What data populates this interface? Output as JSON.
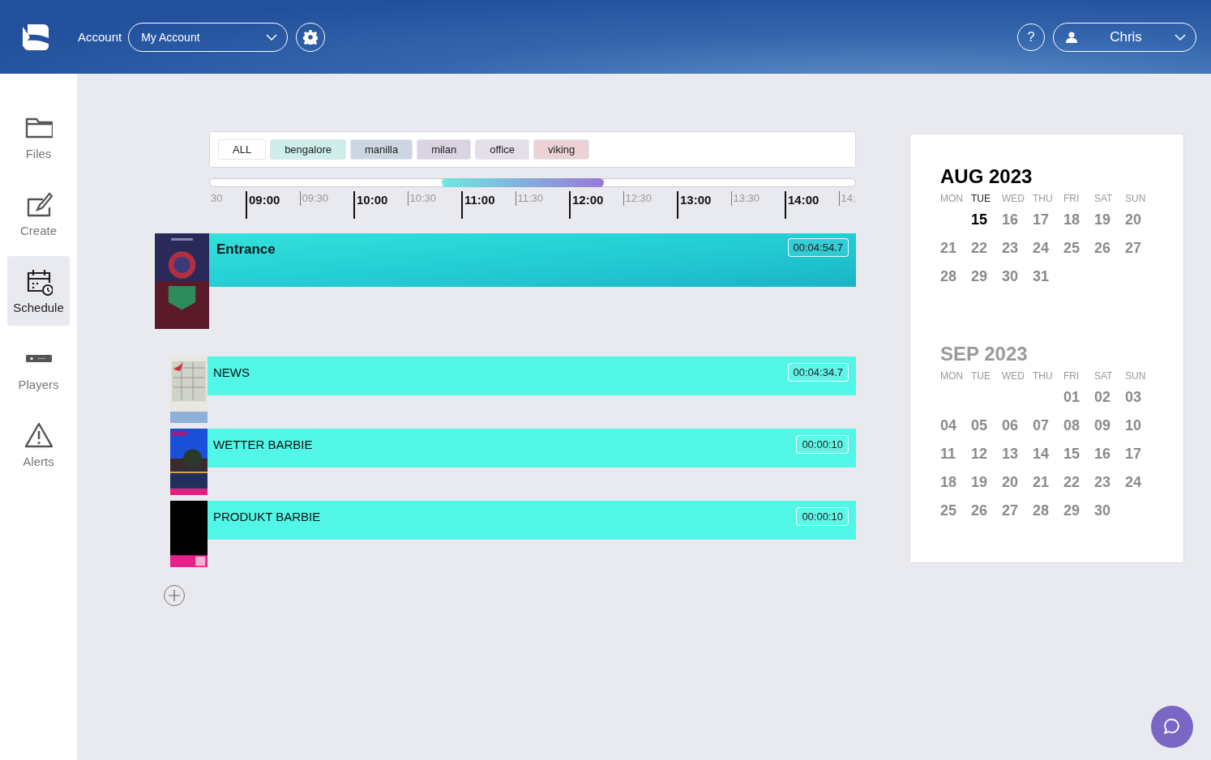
{
  "header": {
    "account_label": "Account",
    "account_select": {
      "value": "My Account"
    },
    "user_select": {
      "value": "Chris"
    },
    "help_button": "?"
  },
  "sidebar": {
    "items": [
      {
        "label": "Files",
        "selected": false
      },
      {
        "label": "Create",
        "selected": false
      },
      {
        "label": "Schedule",
        "selected": true
      },
      {
        "label": "Players",
        "selected": false
      },
      {
        "label": "Alerts",
        "selected": false
      }
    ]
  },
  "filters": [
    {
      "label": "ALL",
      "color": "#ffffff"
    },
    {
      "label": "bengalore",
      "color": "#cdeeea"
    },
    {
      "label": "manilla",
      "color": "#cbd6e2"
    },
    {
      "label": "milan",
      "color": "#dbd3e2"
    },
    {
      "label": "office",
      "color": "#e5dfec"
    },
    {
      "label": "viking",
      "color": "#ecd2d5"
    }
  ],
  "timeline": {
    "ticks": [
      {
        "label": "30",
        "kind": "partial"
      },
      {
        "label": "09:00",
        "kind": "hour"
      },
      {
        "label": "09:30",
        "kind": "half"
      },
      {
        "label": "10:00",
        "kind": "hour"
      },
      {
        "label": "10:30",
        "kind": "half"
      },
      {
        "label": "11:00",
        "kind": "hour"
      },
      {
        "label": "11:30",
        "kind": "half"
      },
      {
        "label": "12:00",
        "kind": "hour"
      },
      {
        "label": "12:30",
        "kind": "half"
      },
      {
        "label": "13:00",
        "kind": "hour"
      },
      {
        "label": "13:30",
        "kind": "half"
      },
      {
        "label": "14:00",
        "kind": "hour"
      },
      {
        "label": "14:",
        "kind": "half"
      }
    ]
  },
  "schedule": {
    "rows": [
      {
        "kind": "group",
        "name": "Entrance",
        "duration": "00:04:54.7"
      },
      {
        "kind": "item",
        "name": "NEWS",
        "duration": "00:04:34.7"
      },
      {
        "kind": "item",
        "name": "WETTER BARBIE",
        "duration": "00:00:10"
      },
      {
        "kind": "item",
        "name": "PRODUKT BARBIE",
        "duration": "00:00:10"
      }
    ]
  },
  "calendar": {
    "months": [
      {
        "title": "AUG 2023",
        "current": true,
        "weekdays": [
          {
            "label": "MON",
            "today": false
          },
          {
            "label": "TUE",
            "today": true
          },
          {
            "label": "WED",
            "today": false
          },
          {
            "label": "THU",
            "today": false
          },
          {
            "label": "FRI",
            "today": false
          },
          {
            "label": "SAT",
            "today": false
          },
          {
            "label": "SUN",
            "today": false
          }
        ],
        "weeks": [
          {
            "kind": "leading",
            "days": [
              {
                "day": "15",
                "today": true
              },
              {
                "day": "16",
                "today": false
              },
              {
                "day": "17",
                "today": false
              },
              {
                "day": "18",
                "today": false
              },
              {
                "day": "19",
                "today": false
              },
              {
                "day": "20",
                "today": false
              }
            ]
          },
          {
            "kind": "full",
            "days": [
              {
                "day": "21",
                "today": false
              },
              {
                "day": "22",
                "today": false
              },
              {
                "day": "23",
                "today": false
              },
              {
                "day": "24",
                "today": false
              },
              {
                "day": "25",
                "today": false
              },
              {
                "day": "26",
                "today": false
              },
              {
                "day": "27",
                "today": false
              }
            ]
          },
          {
            "kind": "trailing",
            "days": [
              {
                "day": "28",
                "today": false
              },
              {
                "day": "29",
                "today": false
              },
              {
                "day": "30",
                "today": false
              },
              {
                "day": "31",
                "today": false
              }
            ]
          }
        ]
      },
      {
        "title": "SEP 2023",
        "current": false,
        "weekdays": [
          {
            "label": "MON",
            "today": false
          },
          {
            "label": "TUE",
            "today": false
          },
          {
            "label": "WED",
            "today": false
          },
          {
            "label": "THU",
            "today": false
          },
          {
            "label": "FRI",
            "today": false
          },
          {
            "label": "SAT",
            "today": false
          },
          {
            "label": "SUN",
            "today": false
          }
        ],
        "weeks": [
          {
            "kind": "leading",
            "days": [
              {
                "day": "01",
                "today": false
              },
              {
                "day": "02",
                "today": false
              },
              {
                "day": "03",
                "today": false
              }
            ]
          },
          {
            "kind": "full",
            "days": [
              {
                "day": "04",
                "today": false
              },
              {
                "day": "05",
                "today": false
              },
              {
                "day": "06",
                "today": false
              },
              {
                "day": "07",
                "today": false
              },
              {
                "day": "08",
                "today": false
              },
              {
                "day": "09",
                "today": false
              },
              {
                "day": "10",
                "today": false
              }
            ]
          },
          {
            "kind": "full",
            "days": [
              {
                "day": "11",
                "today": false
              },
              {
                "day": "12",
                "today": false
              },
              {
                "day": "13",
                "today": false
              },
              {
                "day": "14",
                "today": false
              },
              {
                "day": "15",
                "today": false
              },
              {
                "day": "16",
                "today": false
              },
              {
                "day": "17",
                "today": false
              }
            ]
          },
          {
            "kind": "full",
            "days": [
              {
                "day": "18",
                "today": false
              },
              {
                "day": "19",
                "today": false
              },
              {
                "day": "20",
                "today": false
              },
              {
                "day": "21",
                "today": false
              },
              {
                "day": "22",
                "today": false
              },
              {
                "day": "23",
                "today": false
              },
              {
                "day": "24",
                "today": false
              }
            ]
          },
          {
            "kind": "trailing",
            "days": [
              {
                "day": "25",
                "today": false
              },
              {
                "day": "26",
                "today": false
              },
              {
                "day": "27",
                "today": false
              },
              {
                "day": "28",
                "today": false
              },
              {
                "day": "29",
                "today": false
              },
              {
                "day": "30",
                "today": false
              }
            ]
          }
        ]
      }
    ]
  }
}
